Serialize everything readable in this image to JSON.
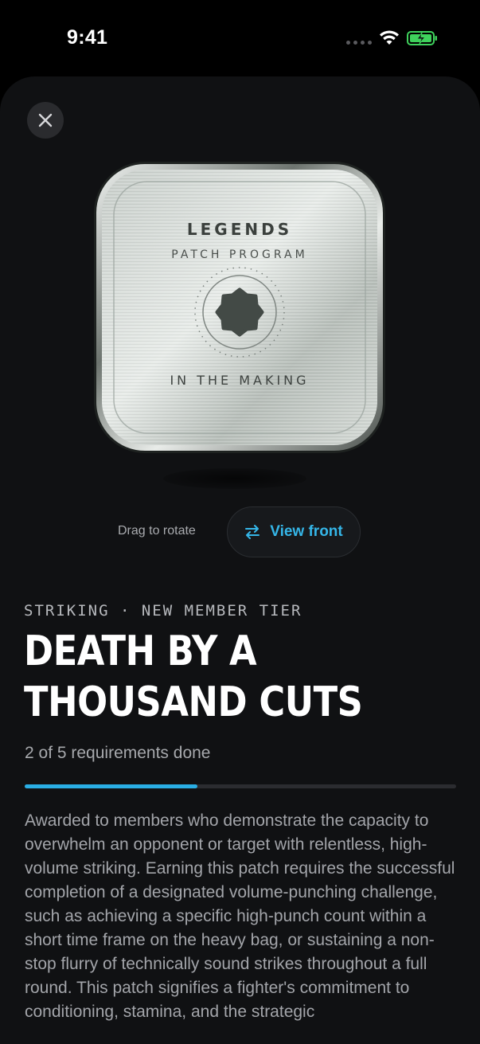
{
  "status": {
    "time": "9:41"
  },
  "patch": {
    "title": "LEGENDS",
    "subtitle": "PATCH PROGRAM",
    "bottom_text": "IN THE MAKING"
  },
  "controls": {
    "drag_hint": "Drag to rotate",
    "view_front_label": "View front"
  },
  "challenge": {
    "eyebrow": "STRIKING · NEW MEMBER TIER",
    "title": "DEATH BY A THOUSAND CUTS",
    "progress_text": "2 of 5 requirements done",
    "progress_done": 2,
    "progress_total": 5,
    "description": "Awarded to members who demonstrate the capacity to overwhelm an opponent or target with relentless, high-volume striking. Earning this patch requires the successful completion of a designated volume-punching challenge, such as achieving a specific high-punch count within a short time frame on the heavy bag, or sustaining a non-stop flurry of technically sound strikes throughout a full round. This patch signifies a fighter's commitment to conditioning, stamina, and the strategic"
  },
  "colors": {
    "accent": "#2aaee4",
    "background": "#101113",
    "battery": "#3fd15c"
  }
}
